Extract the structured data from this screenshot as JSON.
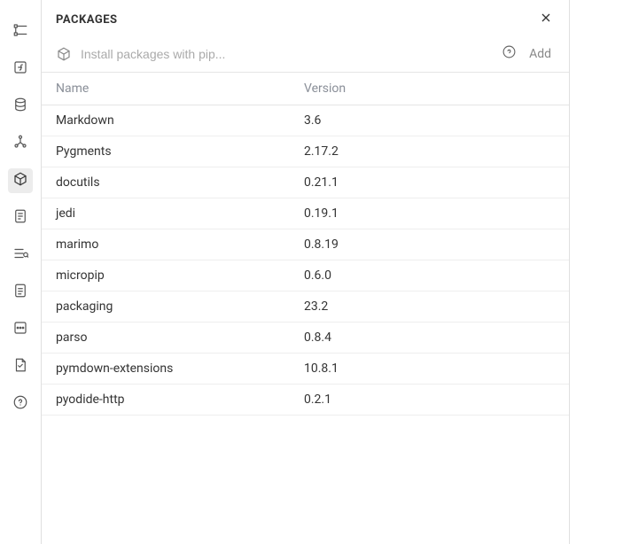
{
  "sidebar": {
    "items": [
      {
        "name": "file-tree-icon"
      },
      {
        "name": "function-icon"
      },
      {
        "name": "database-icon"
      },
      {
        "name": "graph-icon"
      },
      {
        "name": "package-icon"
      },
      {
        "name": "scratchpad-icon"
      },
      {
        "name": "outline-icon"
      },
      {
        "name": "snippets-icon"
      },
      {
        "name": "code-block-icon"
      },
      {
        "name": "docs-icon"
      },
      {
        "name": "feedback-icon"
      }
    ],
    "active_index": 4
  },
  "panel": {
    "title": "PACKAGES",
    "close_label": "Close"
  },
  "search": {
    "placeholder": "Install packages with pip...",
    "value": "",
    "add_label": "Add"
  },
  "table": {
    "headers": {
      "name": "Name",
      "version": "Version"
    },
    "rows": [
      {
        "name": "Markdown",
        "version": "3.6"
      },
      {
        "name": "Pygments",
        "version": "2.17.2"
      },
      {
        "name": "docutils",
        "version": "0.21.1"
      },
      {
        "name": "jedi",
        "version": "0.19.1"
      },
      {
        "name": "marimo",
        "version": "0.8.19"
      },
      {
        "name": "micropip",
        "version": "0.6.0"
      },
      {
        "name": "packaging",
        "version": "23.2"
      },
      {
        "name": "parso",
        "version": "0.8.4"
      },
      {
        "name": "pymdown-extensions",
        "version": "10.8.1"
      },
      {
        "name": "pyodide-http",
        "version": "0.2.1"
      }
    ]
  }
}
